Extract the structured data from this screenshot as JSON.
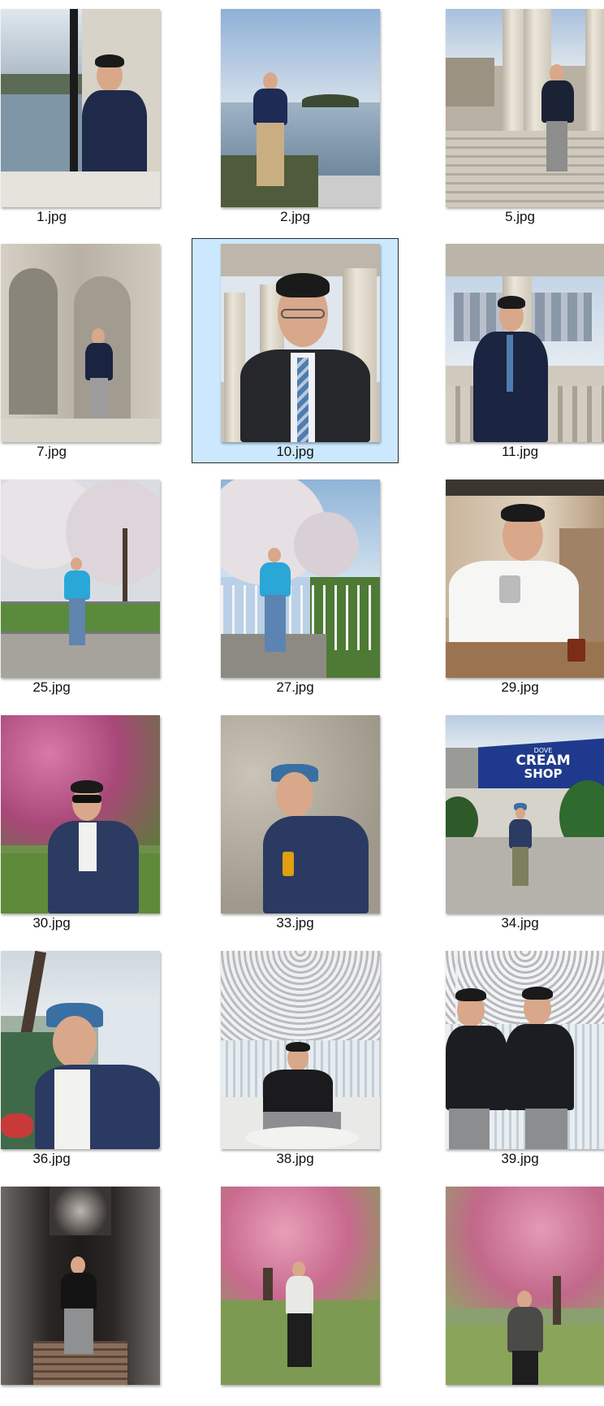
{
  "files": [
    {
      "name": "1.jpg",
      "selected": false
    },
    {
      "name": "2.jpg",
      "selected": false
    },
    {
      "name": "5.jpg",
      "selected": false
    },
    {
      "name": "7.jpg",
      "selected": false
    },
    {
      "name": "10.jpg",
      "selected": true
    },
    {
      "name": "11.jpg",
      "selected": false
    },
    {
      "name": "25.jpg",
      "selected": false
    },
    {
      "name": "27.jpg",
      "selected": false
    },
    {
      "name": "29.jpg",
      "selected": false
    },
    {
      "name": "30.jpg",
      "selected": false
    },
    {
      "name": "33.jpg",
      "selected": false
    },
    {
      "name": "34.jpg",
      "selected": false
    },
    {
      "name": "36.jpg",
      "selected": false
    },
    {
      "name": "38.jpg",
      "selected": false
    },
    {
      "name": "39.jpg",
      "selected": false
    },
    {
      "name": "",
      "selected": false
    },
    {
      "name": "",
      "selected": false
    },
    {
      "name": "",
      "selected": false
    }
  ],
  "photo_texts": {
    "sign_brand": "DOVE",
    "sign_line1": "CREAM",
    "sign_line2": "SHOP"
  },
  "colors": {
    "selection_fill": "#cce8ff",
    "selection_border": "#2b2b2b",
    "label_text": "#111111"
  }
}
